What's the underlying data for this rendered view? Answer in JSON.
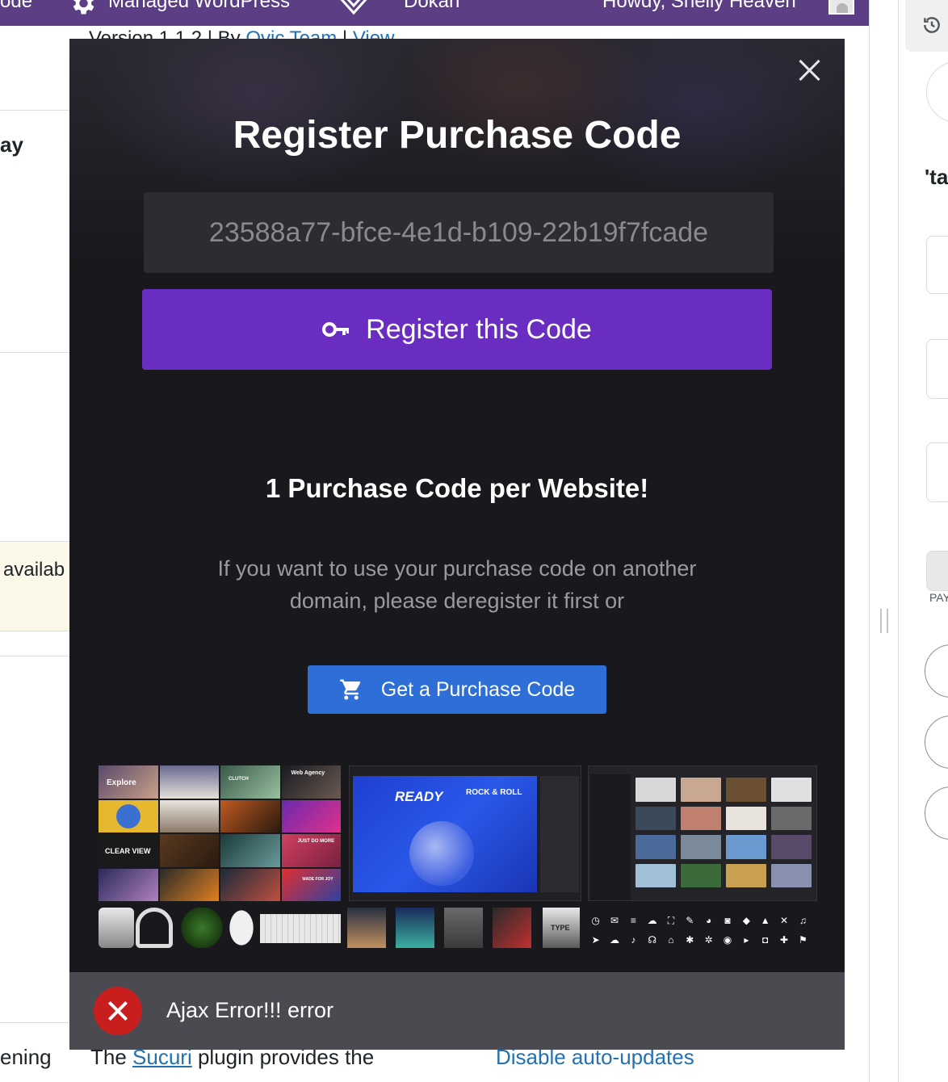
{
  "adminbar": {
    "code_partial": "ode",
    "managed": "Managed WordPress",
    "dokan": "Dokan",
    "howdy": "Howdy, Shelly Heaven"
  },
  "background": {
    "version_prefix": "Version 1.1.2 | By ",
    "version_link1": "Ovic Team",
    "version_sep": " | ",
    "version_link2": "View",
    "ay": "ay",
    "availab": "availab",
    "ening": "ening",
    "sucuri_pre": "The ",
    "sucuri_link": "Sucuri",
    "sucuri_post": " plugin provides the",
    "disable": "Disable auto-updates"
  },
  "right_panel": {
    "ta": "'ta",
    "pay": "PAY"
  },
  "modal": {
    "title": "Register Purchase Code",
    "code_value": "23588a77-bfce-4e1d-b109-22b19f7fcade",
    "register_label": "Register this Code",
    "per_site": "1 Purchase Code per Website!",
    "info": "If you want to use your purchase code on another domain, please deregister it first or",
    "purchase_label": "Get a Purchase Code",
    "collage": {
      "tile_labels": {
        "explore": "Explore",
        "clutch": "CLUTCH",
        "web_agency": "Web Agency",
        "clear_view": "CLEAR VIEW",
        "just_do": "JUST DO MORE",
        "made_for": "MADE FOR JOY",
        "ready": "READY",
        "rock": "ROCK & ROLL",
        "type": "TYPE"
      }
    },
    "toast": {
      "text": "Ajax Error!!! error"
    }
  },
  "colors": {
    "modal_bg": "#18181d",
    "register_btn": "#6a2dc1",
    "purchase_btn": "#2d6fd7",
    "error_red": "#c81e1e",
    "adminbar": "#5b3e84"
  }
}
